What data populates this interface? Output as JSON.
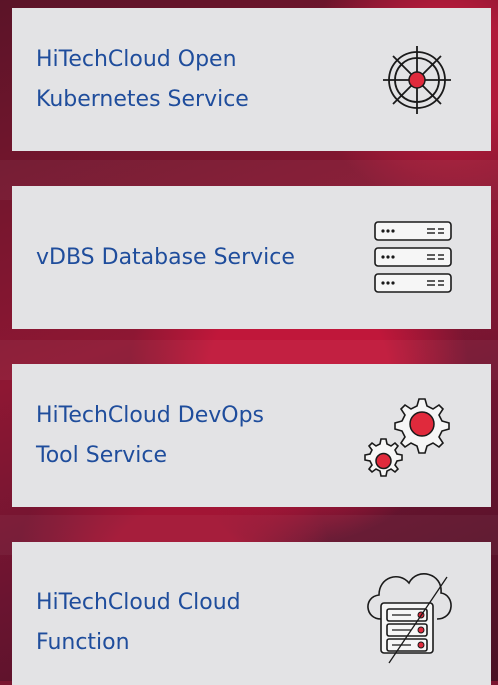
{
  "services": [
    {
      "title_line1": "HiTechCloud Open",
      "title_line2": "Kubernetes Service",
      "icon": "helm-wheel-icon"
    },
    {
      "title_line1": "vDBS Database Service",
      "title_line2": "",
      "icon": "database-servers-icon"
    },
    {
      "title_line1": "HiTechCloud DevOps",
      "title_line2": "Tool Service",
      "icon": "gears-icon"
    },
    {
      "title_line1": "HiTechCloud Cloud",
      "title_line2": "Function",
      "icon": "cloud-server-icon"
    }
  ],
  "colors": {
    "card_bg": "#e3e3e5",
    "title": "#1f4d9c",
    "accent": "#e02a3c",
    "background": "#7a1630"
  }
}
